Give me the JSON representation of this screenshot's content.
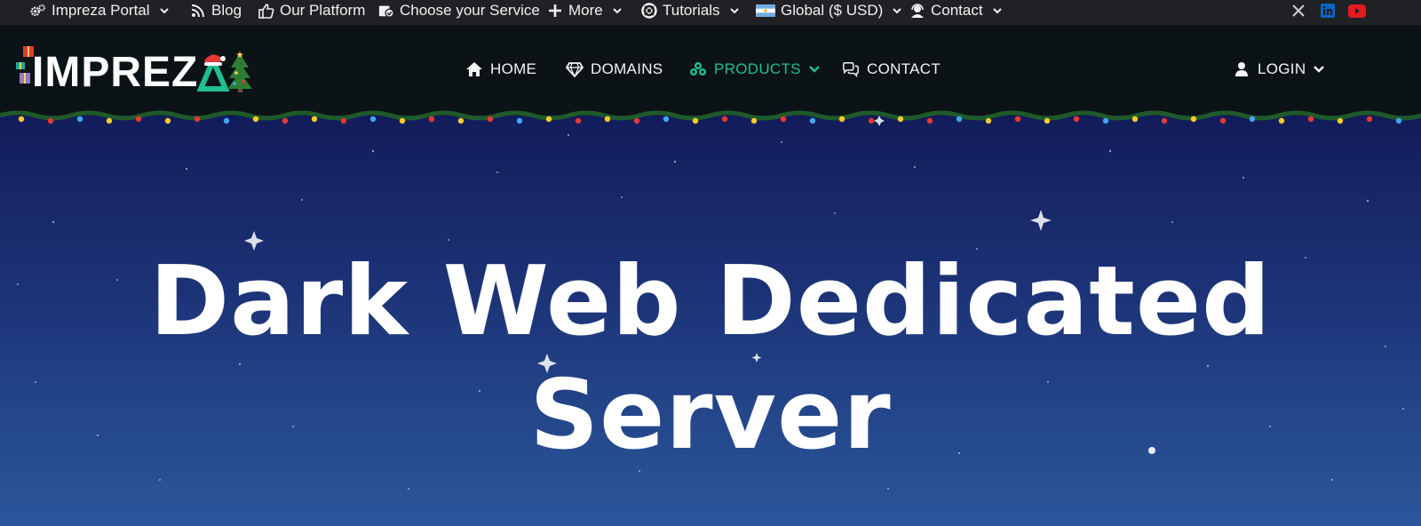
{
  "topbar": {
    "items": [
      {
        "label": "Impreza Portal",
        "icon": "gears-icon",
        "has_dropdown": true
      },
      {
        "label": "Blog",
        "icon": "rss-icon",
        "has_dropdown": false
      },
      {
        "label": "Our Platform",
        "icon": "thumbs-up-icon",
        "has_dropdown": false
      },
      {
        "label": "Choose your Service",
        "icon": "box-check-icon",
        "has_dropdown": false
      },
      {
        "label": "More",
        "icon": "plus-icon",
        "has_dropdown": true
      },
      {
        "label": "Tutorials",
        "icon": "lifebuoy-icon",
        "has_dropdown": true
      },
      {
        "label": "Global ($ USD)",
        "icon": "flag-icon",
        "has_dropdown": true
      },
      {
        "label": "Contact",
        "icon": "headset-icon",
        "has_dropdown": true
      }
    ],
    "social": [
      {
        "name": "x-icon",
        "color": "#1a1a1a"
      },
      {
        "name": "linkedin-icon",
        "color": "#0a66c2"
      },
      {
        "name": "youtube-icon",
        "color": "#e21b1b"
      }
    ]
  },
  "logo": {
    "text": "IMPREZ",
    "accent_letter_color": "#1fbf8f"
  },
  "nav": {
    "items": [
      {
        "label": "HOME",
        "icon": "home-icon"
      },
      {
        "label": "DOMAINS",
        "icon": "diamond-icon"
      },
      {
        "label": "PRODUCTS",
        "icon": "cubes-icon",
        "active": true,
        "has_dropdown": true
      },
      {
        "label": "CONTACT",
        "icon": "comments-icon"
      }
    ],
    "login": {
      "label": "LOGIN",
      "icon": "user-icon",
      "has_dropdown": true
    }
  },
  "hero": {
    "title_line1": "Dark Web Dedicated",
    "title_line2": "Server"
  },
  "colors": {
    "topbar_bg": "#202124",
    "nav_bg": "#0c1316",
    "accent": "#1fbf8f",
    "hero_top": "#121c5a",
    "hero_bottom": "#2b579c"
  }
}
